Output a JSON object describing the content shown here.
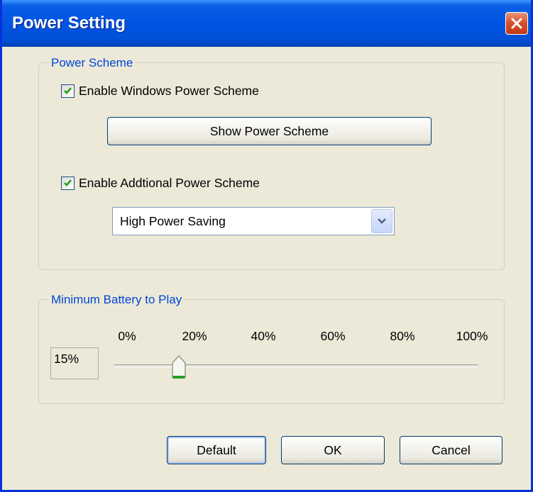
{
  "window": {
    "title": "Power Setting"
  },
  "power_scheme": {
    "legend": "Power Scheme",
    "enable_windows": {
      "label": "Enable Windows Power Scheme",
      "checked": true
    },
    "show_button": "Show Power Scheme",
    "enable_additional": {
      "label": "Enable Addtional Power Scheme",
      "checked": true
    },
    "dropdown": {
      "selected": "High Power Saving"
    }
  },
  "battery": {
    "legend": "Minimum Battery to Play",
    "ticks": [
      "0%",
      "20%",
      "40%",
      "60%",
      "80%",
      "100%"
    ],
    "value_text": "15%",
    "value": 15,
    "min": 0,
    "max": 100
  },
  "buttons": {
    "default": "Default",
    "ok": "OK",
    "cancel": "Cancel"
  },
  "colors": {
    "accent": "#0054e3",
    "legend": "#0046d5",
    "check": "#21a121"
  }
}
